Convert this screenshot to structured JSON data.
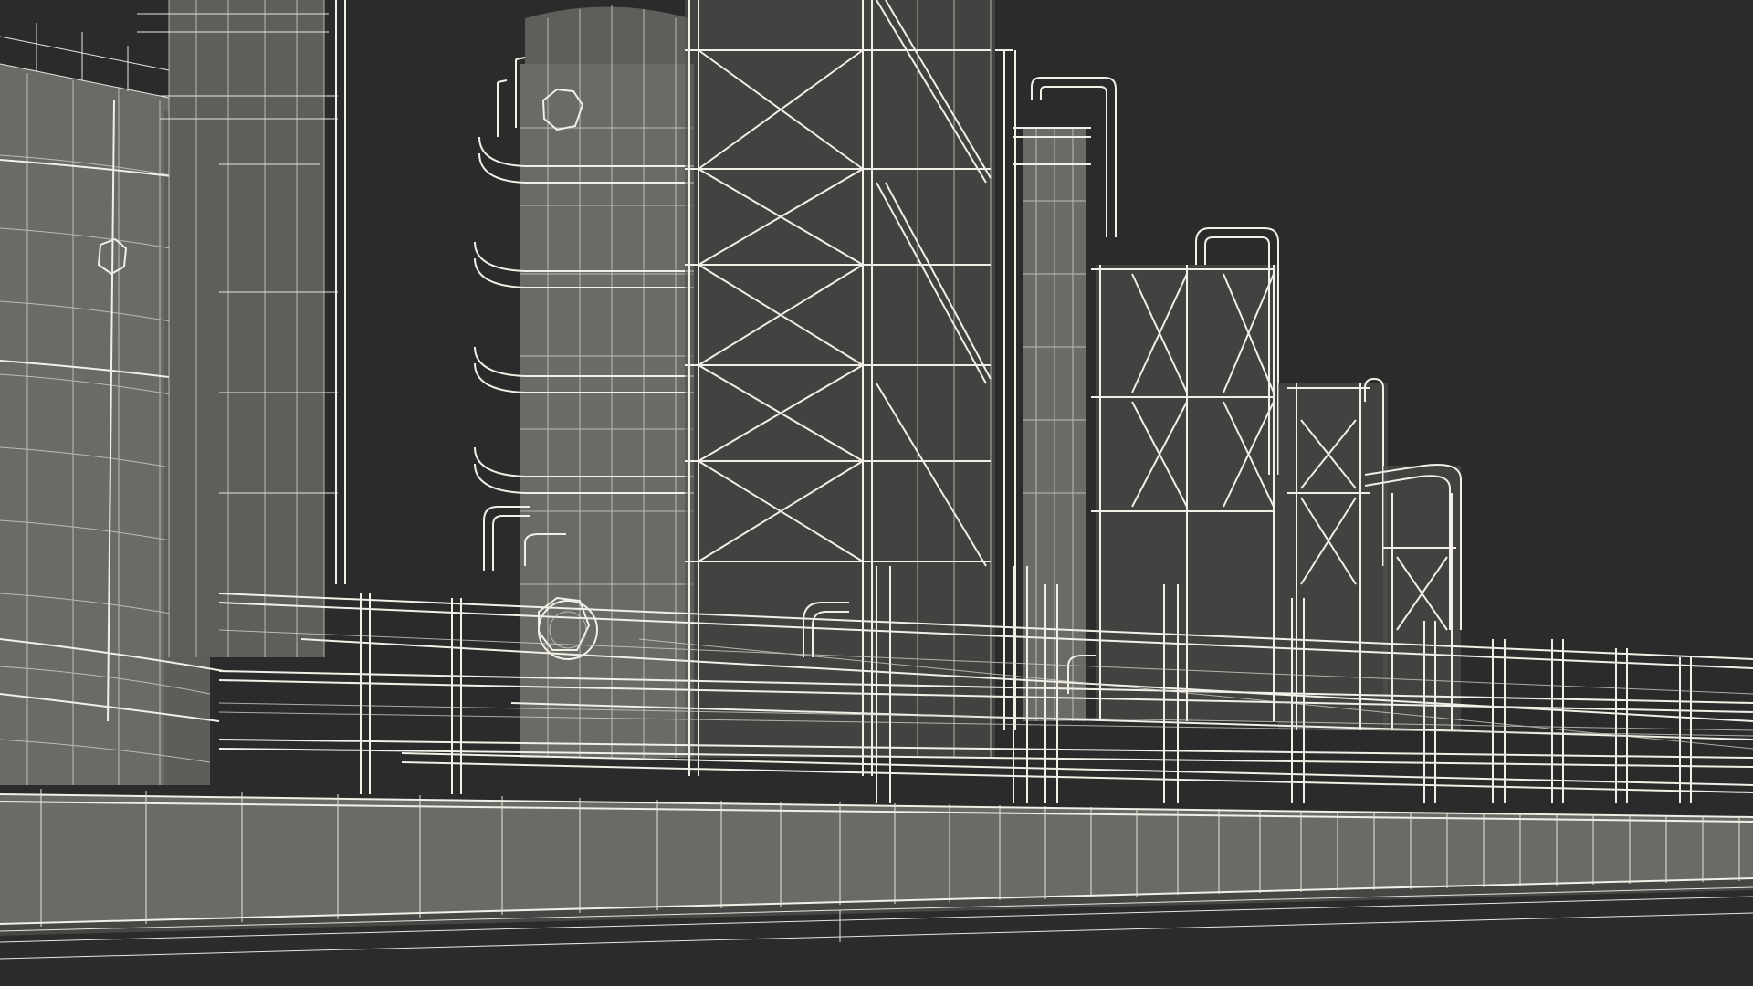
{
  "scene": {
    "subject": "refinery-wireframe-render",
    "colors": {
      "background": "#2b2b2b",
      "surface": "#6a6a66",
      "surface_shadow": "#525250",
      "wire": "#e8e6dc"
    }
  }
}
